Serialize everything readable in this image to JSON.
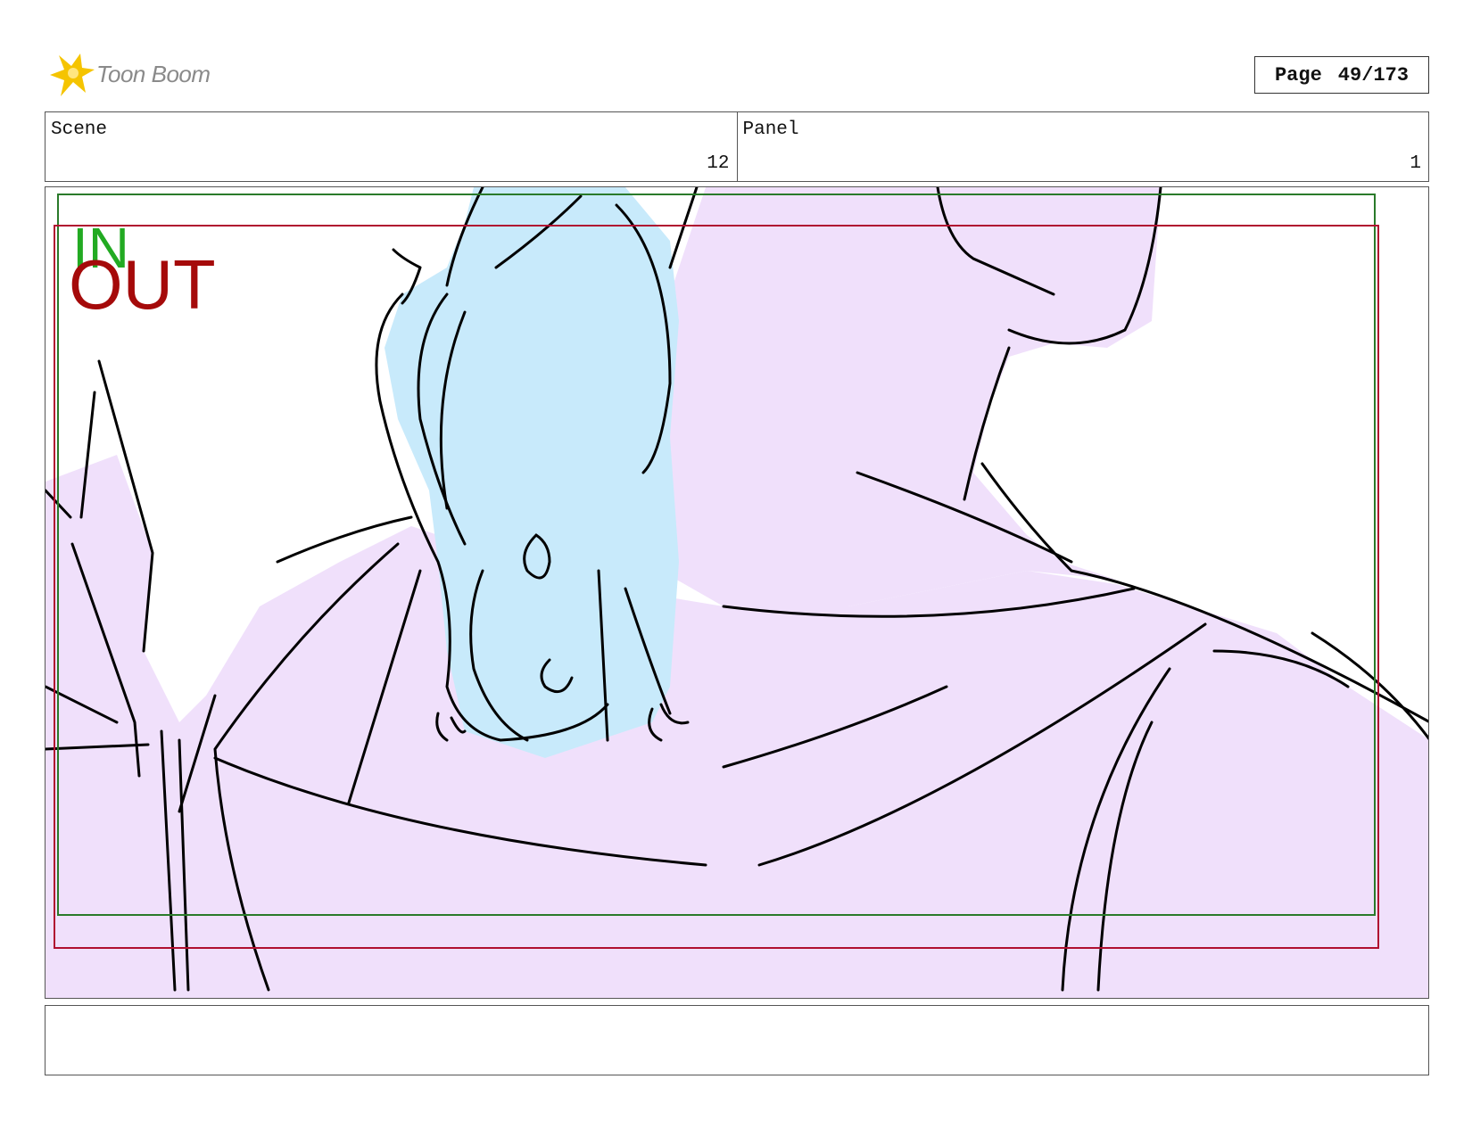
{
  "header": {
    "logo_text": "Toon Boom",
    "page_label": "Page",
    "page_value": "49/173"
  },
  "info": {
    "scene_label": "Scene",
    "scene_value": "12",
    "panel_label": "Panel",
    "panel_value": "1"
  },
  "panel": {
    "in_label": "IN",
    "out_label": "OUT",
    "colors": {
      "shirt_fill": "#f0e0fb",
      "creature_fill": "#c8eafb",
      "in_frame": "#2a7a2a",
      "out_frame": "#b01030",
      "line": "#000000"
    }
  },
  "caption": {
    "text": ""
  }
}
